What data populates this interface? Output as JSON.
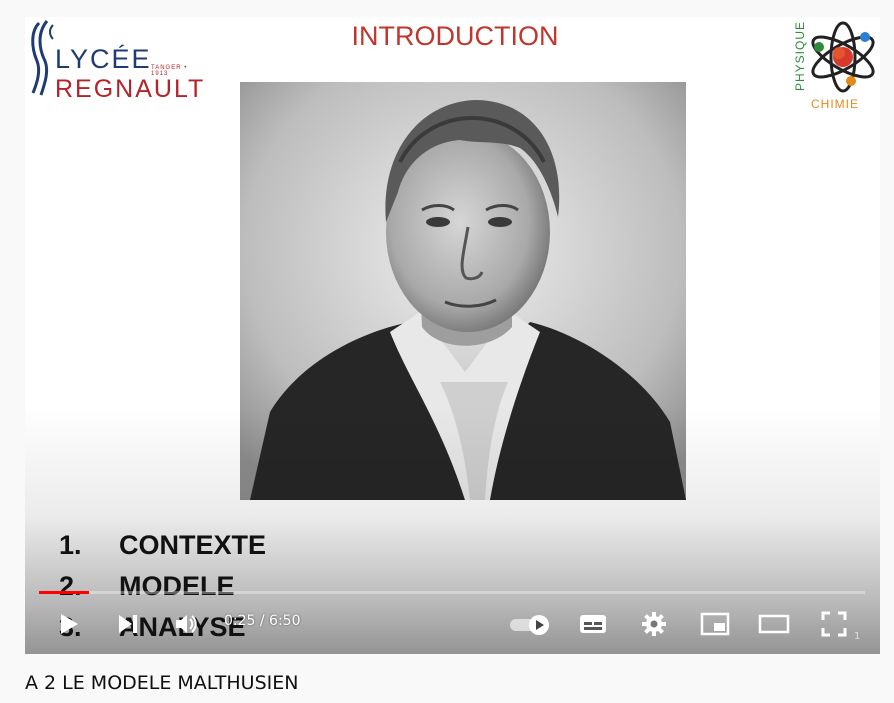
{
  "slide": {
    "title": "INTRODUCTION",
    "school_logo": {
      "line1": "LYCÉE",
      "line2": "REGNAULT",
      "tagline": "TANGER • 1913"
    },
    "subject_logo": {
      "vertical": "PHYSIQUE",
      "horizontal": "CHIMIE"
    },
    "outline": [
      {
        "num": "1.",
        "label": "CONTEXTE"
      },
      {
        "num": "2.",
        "label": "MODELE"
      },
      {
        "num": "3.",
        "label": "ANALYSE"
      }
    ]
  },
  "player": {
    "current_time": "0:25",
    "duration": "6:50",
    "time_text": "0:25 / 6:50",
    "progress_fraction": 0.061,
    "corner_badge": "1",
    "accent_color": "#ff0000",
    "controls": {
      "play": "play-icon",
      "next": "next-icon",
      "volume": "volume-icon",
      "autoplay": "autoplay-toggle-icon",
      "subtitles": "subtitles-icon",
      "settings": "gear-icon",
      "miniplayer": "miniplayer-icon",
      "theater": "theater-mode-icon",
      "fullscreen": "fullscreen-icon"
    }
  },
  "video": {
    "title": "A 2 LE MODELE MALTHUSIEN"
  }
}
